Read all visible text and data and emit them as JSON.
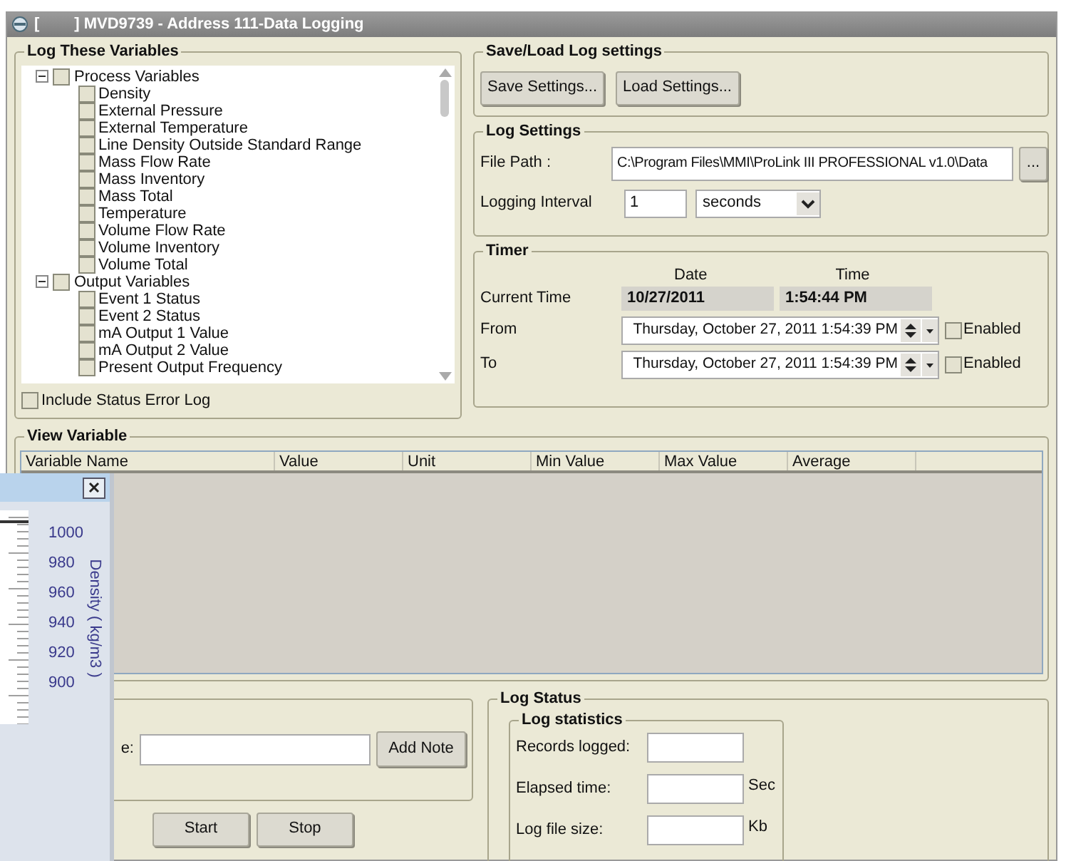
{
  "window": {
    "title": "[        ] MVD9739 - Address 111-Data Logging"
  },
  "log_variables": {
    "title": "Log These Variables",
    "tree": [
      {
        "label": "Process Variables",
        "checked": false,
        "expanded": true,
        "children": [
          {
            "label": "Density",
            "checked": false
          },
          {
            "label": "External Pressure",
            "checked": false
          },
          {
            "label": "External Temperature",
            "checked": false
          },
          {
            "label": "Line Density Outside Standard Range",
            "checked": false
          },
          {
            "label": "Mass Flow Rate",
            "checked": false
          },
          {
            "label": "Mass Inventory",
            "checked": false
          },
          {
            "label": "Mass Total",
            "checked": false
          },
          {
            "label": "Temperature",
            "checked": false
          },
          {
            "label": "Volume Flow Rate",
            "checked": false
          },
          {
            "label": "Volume Inventory",
            "checked": false
          },
          {
            "label": "Volume Total",
            "checked": false
          }
        ]
      },
      {
        "label": "Output Variables",
        "checked": false,
        "expanded": true,
        "children": [
          {
            "label": "Event 1 Status",
            "checked": false
          },
          {
            "label": "Event 2 Status",
            "checked": false
          },
          {
            "label": "mA Output 1 Value",
            "checked": false
          },
          {
            "label": "mA Output 2 Value",
            "checked": false
          },
          {
            "label": "Present Output Frequency",
            "checked": false
          }
        ]
      }
    ],
    "include_status_error_log": {
      "label": "Include Status Error Log",
      "checked": false
    }
  },
  "save_load": {
    "title": "Save/Load Log settings",
    "buttons": [
      "Save Settings...",
      "Load Settings..."
    ]
  },
  "log_settings": {
    "title": "Log Settings",
    "file_path_label": "File Path :",
    "file_path": "C:\\Program Files\\MMI\\ProLink III PROFESSIONAL v1.0\\Data",
    "browse_button": "...",
    "interval_label": "Logging Interval",
    "interval_value": "1",
    "interval_unit": "seconds"
  },
  "timer": {
    "title": "Timer",
    "date_header": "Date",
    "time_header": "Time",
    "current_label": "Current Time",
    "current_date": "10/27/2011",
    "current_time": "1:54:44 PM",
    "ranges": [
      {
        "label": "From",
        "value": "Thursday, October 27, 2011 1:54:39 PM",
        "enabled_label": "Enabled",
        "enabled": false
      },
      {
        "label": "To",
        "value": "Thursday, October 27, 2011 1:54:39 PM",
        "enabled_label": "Enabled",
        "enabled": false
      }
    ]
  },
  "view_variable": {
    "title": "View Variable",
    "columns": [
      "Variable Name",
      "Value",
      "Unit",
      "Min Value",
      "Max Value",
      "Average"
    ]
  },
  "note": {
    "label": "e:",
    "button": "Add Note"
  },
  "controls": [
    "Start",
    "Stop"
  ],
  "log_status": {
    "title": "Log Status",
    "statistics_title": "Log statistics",
    "rows": [
      {
        "label": "Records logged:"
      },
      {
        "label": "Elapsed time:",
        "unit": "Sec"
      },
      {
        "label": "Log file size:",
        "unit": "Kb"
      }
    ]
  },
  "chart_window": {
    "axis_labels": [
      "1000",
      "980",
      "960",
      "940",
      "920",
      "900"
    ],
    "axis_title": "Density ( kg/m3 )"
  }
}
